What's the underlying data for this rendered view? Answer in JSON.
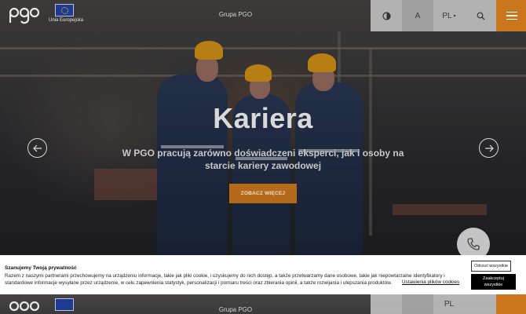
{
  "header": {
    "eu_label": "Unia Europejska",
    "group_label": "Grupa PGO",
    "language": "PL",
    "contrast_icon": "contrast-icon",
    "font_size_label": "A",
    "search_icon": "search-icon",
    "menu_icon": "hamburger-menu-icon"
  },
  "hero": {
    "title": "Kariera",
    "subtitle": "W PGO pracują zarówno doświadczeni eksperci, jak i osoby na starcie kariery zawodowej",
    "cta_label": "ZOBACZ WIĘCEJ",
    "prev_icon": "arrow-left-icon",
    "next_icon": "arrow-right-icon",
    "phone_icon": "phone-icon"
  },
  "cookie": {
    "title": "Szanujemy Twoją prywatność",
    "text": "Razem z naszymi partnerami przechowujemy na urządzeniu informacje, takie jak pliki cookie, i uzyskujemy do nich dostęp, a także przetwarzamy dane osobowe, takie jak niepowtarzalne identyfikatory i standardowe informacje wysyłane przez urządzenie, w celu zapewnienia statystyk, personalizacji i pomiaru treści oraz zbierania opinii, a także rozwijania i ulepszania produktów.",
    "settings_link": "Ustawienia plików cookies",
    "reject_label": "Odrzuć wszystkie",
    "accept_label": "Zaakceptuj wszystkie"
  },
  "colors": {
    "accent": "#c9761d",
    "helmet": "#e8a319"
  }
}
